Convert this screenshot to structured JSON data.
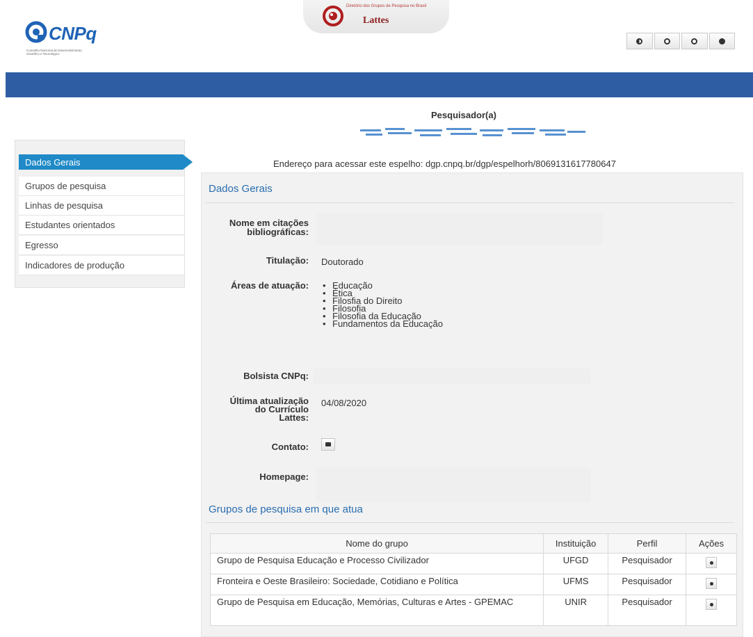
{
  "header": {
    "cnpq_logo_text": "CNPq",
    "cnpq_tagline": "Conselho Nacional de Desenvolvimento Científico e Tecnológico",
    "lattes_subtitle": "Diretório dos Grupos de Pesquisa no Brasil",
    "lattes_title": "Lattes",
    "toolbar": [
      {
        "icon": "contrast-icon"
      },
      {
        "icon": "font-decrease-icon"
      },
      {
        "icon": "font-increase-icon"
      },
      {
        "icon": "info-icon"
      }
    ]
  },
  "colors": {
    "brand_bar": "#2f5da3",
    "active_menu": "#1f8ac7",
    "section_title": "#2a6eb0"
  },
  "sidebar": {
    "active": "Dados Gerais",
    "items": [
      {
        "label": "Grupos de pesquisa"
      },
      {
        "label": "Linhas de pesquisa"
      },
      {
        "label": "Estudantes orientados"
      },
      {
        "label": "Egresso"
      },
      {
        "label": "Indicadores de produção"
      }
    ]
  },
  "page": {
    "role_label": "Pesquisador(a)",
    "address_label": "Endereço para acessar este espelho: dgp.cnpq.br/dgp/espelhorh/8069131617780647"
  },
  "dados_gerais": {
    "section_title": "Dados Gerais",
    "nome_label_1": "Nome em citações",
    "nome_label_2": "bibliográficas:",
    "titulacao_label": "Titulação:",
    "titulacao_value": "Doutorado",
    "areas_label": "Áreas de atuação:",
    "areas": [
      "Educação",
      "Ética",
      "Filosfia do Direito",
      "Filosofia",
      "Filosofia da Educação",
      "Fundamentos da Educação"
    ],
    "bolsista_label": "Bolsista CNPq:",
    "atualizacao_label_1": "Última atualização",
    "atualizacao_label_2": "do Currículo",
    "atualizacao_label_3": "Lattes:",
    "atualizacao_value": "04/08/2020",
    "contato_label": "Contato:",
    "homepage_label": "Homepage:"
  },
  "grupos": {
    "section_title": "Grupos de pesquisa em que atua",
    "columns": [
      "Nome do grupo",
      "Instituição",
      "Perfil",
      "Ações"
    ],
    "rows": [
      {
        "nome": "Grupo de Pesquisa Educação e Processo Civilizador",
        "instituicao": "UFGD",
        "perfil": "Pesquisador"
      },
      {
        "nome": "Fronteira e Oeste Brasileiro: Sociedade, Cotidiano e Política",
        "instituicao": "UFMS",
        "perfil": "Pesquisador"
      },
      {
        "nome": "Grupo de Pesquisa em Educação, Memórias, Culturas e Artes - GPEMAC",
        "instituicao": "UNIR",
        "perfil": "Pesquisador"
      }
    ]
  }
}
